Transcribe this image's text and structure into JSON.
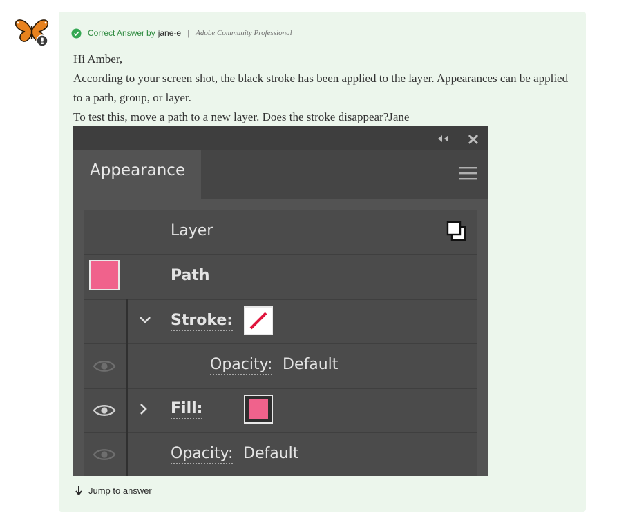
{
  "post": {
    "badge_label": "Correct Answer",
    "by_label": "by",
    "author": "jane-e",
    "separator": "|",
    "author_rank": "Adobe Community Professional",
    "paragraphs": [
      "Hi Amber,",
      "According to your screen shot, the black stroke has been applied to the layer. Appearances can be applied to a path, group, or layer.",
      "To test this, move a path to a new layer. Does the stroke disappear?Jane"
    ],
    "jump_link": "Jump to answer"
  },
  "embedded_screenshot": {
    "panel_title": "Appearance",
    "rows": {
      "layer": "Layer",
      "path": "Path",
      "stroke": "Stroke:",
      "stroke_opacity_label": "Opacity:",
      "stroke_opacity_value": "Default",
      "fill": "Fill:",
      "fill_opacity_label": "Opacity:",
      "fill_opacity_value": "Default"
    },
    "colors": {
      "swatch": "#f0628c",
      "stroke_slash": "#e0143c",
      "panel_bg": "#535353"
    }
  },
  "icons": [
    "butterfly-avatar-icon",
    "check-circle-icon",
    "collapse-icon",
    "close-icon",
    "menu-icon",
    "layer-icon",
    "chevron-down-icon",
    "chevron-right-icon",
    "eye-icon",
    "arrow-down-icon"
  ]
}
